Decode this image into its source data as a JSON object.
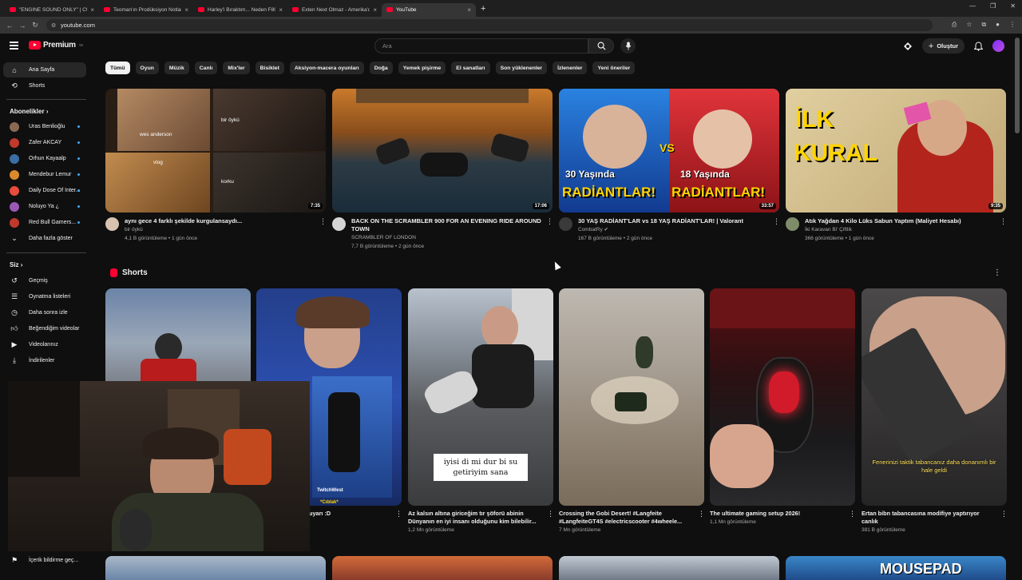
{
  "browser": {
    "tabs": [
      {
        "title": "\"ENGINE SOUND ONLY\" | CUR"
      },
      {
        "title": "Teoman'ın Prodüksiyon Notları"
      },
      {
        "title": "Harley'i Bıraktım... Neden F800"
      },
      {
        "title": "Exten Next Olmaz - Amerika'd"
      },
      {
        "title": "YouTube"
      }
    ],
    "url": "youtube.com"
  },
  "header": {
    "logo_text": "Premium",
    "logo_badge": "TR",
    "search_placeholder": "Ara",
    "create_label": "Oluştur"
  },
  "sidebar": {
    "top": [
      {
        "label": "Ana Sayfa",
        "icon": "home-icon"
      },
      {
        "label": "Shorts",
        "icon": "shorts-icon"
      }
    ],
    "subs_header": "Abonelikler",
    "subs": [
      {
        "label": "Uras Benlioğlu",
        "color": "#8a6a52"
      },
      {
        "label": "Zafer AKCAY",
        "color": "#c0392b"
      },
      {
        "label": "Orhun Kayaalp",
        "color": "#3a6ea5"
      },
      {
        "label": "Mendebur Lemur",
        "color": "#d98b2b"
      },
      {
        "label": "Daily Dose Of Inter...",
        "color": "#e74c3c"
      },
      {
        "label": "Noluyo Ya ¿",
        "color": "#9b59b6"
      },
      {
        "label": "Red Bull Gamers...",
        "color": "#c0392b"
      }
    ],
    "show_more": "Daha fazla göster",
    "you_header": "Siz",
    "you": [
      {
        "label": "Geçmiş",
        "icon": "history-icon"
      },
      {
        "label": "Oynatma listeleri",
        "icon": "playlist-icon"
      },
      {
        "label": "Daha sonra izle",
        "icon": "clock-icon"
      },
      {
        "label": "Beğendiğim videolar",
        "icon": "like-icon"
      },
      {
        "label": "Videolarınız",
        "icon": "video-icon"
      },
      {
        "label": "İndirilenler",
        "icon": "download-icon"
      }
    ],
    "bottom": {
      "label": "İçerik bildirme geç..."
    }
  },
  "chips": [
    "Tümü",
    "Oyun",
    "Müzik",
    "Canlı",
    "Mix'ler",
    "Bisiklet",
    "Aksiyon-macera oyunları",
    "Doğa",
    "Yemek pişirme",
    "El sanatları",
    "Son yüklenenler",
    "İzlenenler",
    "Yeni öneriler"
  ],
  "videos": [
    {
      "title": "aynı gece 4 farklı şekilde kurgulansaydı...",
      "channel": "bir öykü",
      "stats": "4,1 B görüntüleme • 1 gün önce",
      "duration": "7:35",
      "thumb_labels": [
        "bir öykü",
        "wes anderson",
        "vlog",
        "korku"
      ]
    },
    {
      "title": "BACK ON THE SCRAMBLER 900 FOR AN EVENING RIDE AROUND TOWN",
      "channel": "SCRAMBLER OF LONDON",
      "stats": "7,7 B görüntüleme • 2 gün önce",
      "duration": "17:06"
    },
    {
      "title": "30 YAŞ RADİANT'LAR vs 18 YAŞ RADİANT'LAR! | Valorant",
      "channel": "CombatRy",
      "stats": "167 B görüntüleme • 2 gün önce",
      "duration": "33:57",
      "thumb_left": [
        "30 Yaşında",
        "RADİANTLAR!"
      ],
      "thumb_right": [
        "18 Yaşında",
        "RADİANTLAR!"
      ],
      "thumb_vs": "VS"
    },
    {
      "title": "Atık Yağdan 4 Kilo Lüks Sabun Yaptım (Maliyet Hesabı)",
      "channel": "İki Karavan Bi' Çiftlik",
      "stats": "366 görüntüleme • 1 gün önce",
      "duration": "9:35",
      "thumb_text": [
        "İLK",
        "KURAL"
      ]
    }
  ],
  "shorts": {
    "header": "Shorts",
    "items": [
      {
        "title": "",
        "views": ""
      },
      {
        "title": "uyarı :D",
        "views": "",
        "overlay": [
          "TwitchWest",
          "*Cıblak*"
        ]
      },
      {
        "title": "Az kalsın altına giriceğim tır şöforü abinin Dünyanın en iyi insanı olduğunu kim bilebilir...",
        "views": "1,2 Mn görüntüleme",
        "caption": "iyisi di mi dur bi su getiriyim sana"
      },
      {
        "title": "Crossing the Gobi Desert! #Langfeite #LangfeiteGT4S #electricscooter #4wheele...",
        "views": "7 Mn görüntüleme"
      },
      {
        "title": "The ultimate gaming setup 2026!",
        "views": "1,1 Mn görüntüleme"
      },
      {
        "title": "Ertan bibn tabancasına modifiye yaptırıyor canlık",
        "views": "381 B görüntüleme",
        "caption": "Fenerinizi taktik tabancanız daha donanımlı bir hale geldi"
      }
    ]
  },
  "bottom_row": [
    "",
    "",
    "",
    "MOUSEPAD"
  ]
}
